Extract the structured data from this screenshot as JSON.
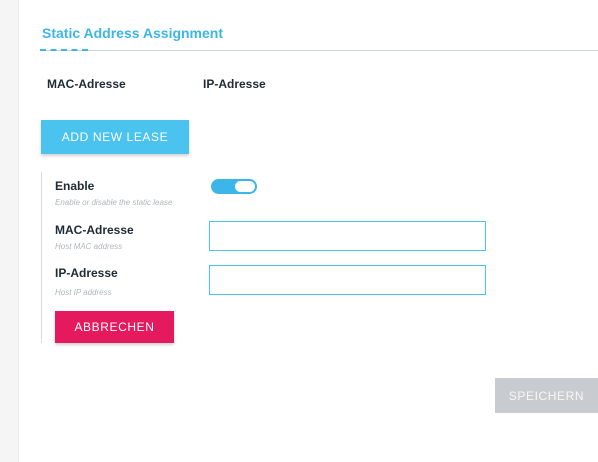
{
  "section": {
    "title": "Static Address Assignment"
  },
  "table": {
    "columns": [
      "MAC-Adresse",
      "IP-Adresse"
    ]
  },
  "actions": {
    "add_label": "ADD NEW LEASE",
    "cancel_label": "ABBRECHEN",
    "save_label": "SPEICHERN"
  },
  "form": {
    "enable": {
      "label": "Enable",
      "hint": "Enable or disable the static lease",
      "value": true
    },
    "mac": {
      "label": "MAC-Adresse",
      "hint": "Host MAC address",
      "value": ""
    },
    "ip": {
      "label": "IP-Adresse",
      "hint": "Host IP address",
      "value": ""
    }
  },
  "colors": {
    "accent": "#3cb6e8",
    "danger": "#e5195e",
    "disabled": "#c8ccd0"
  }
}
